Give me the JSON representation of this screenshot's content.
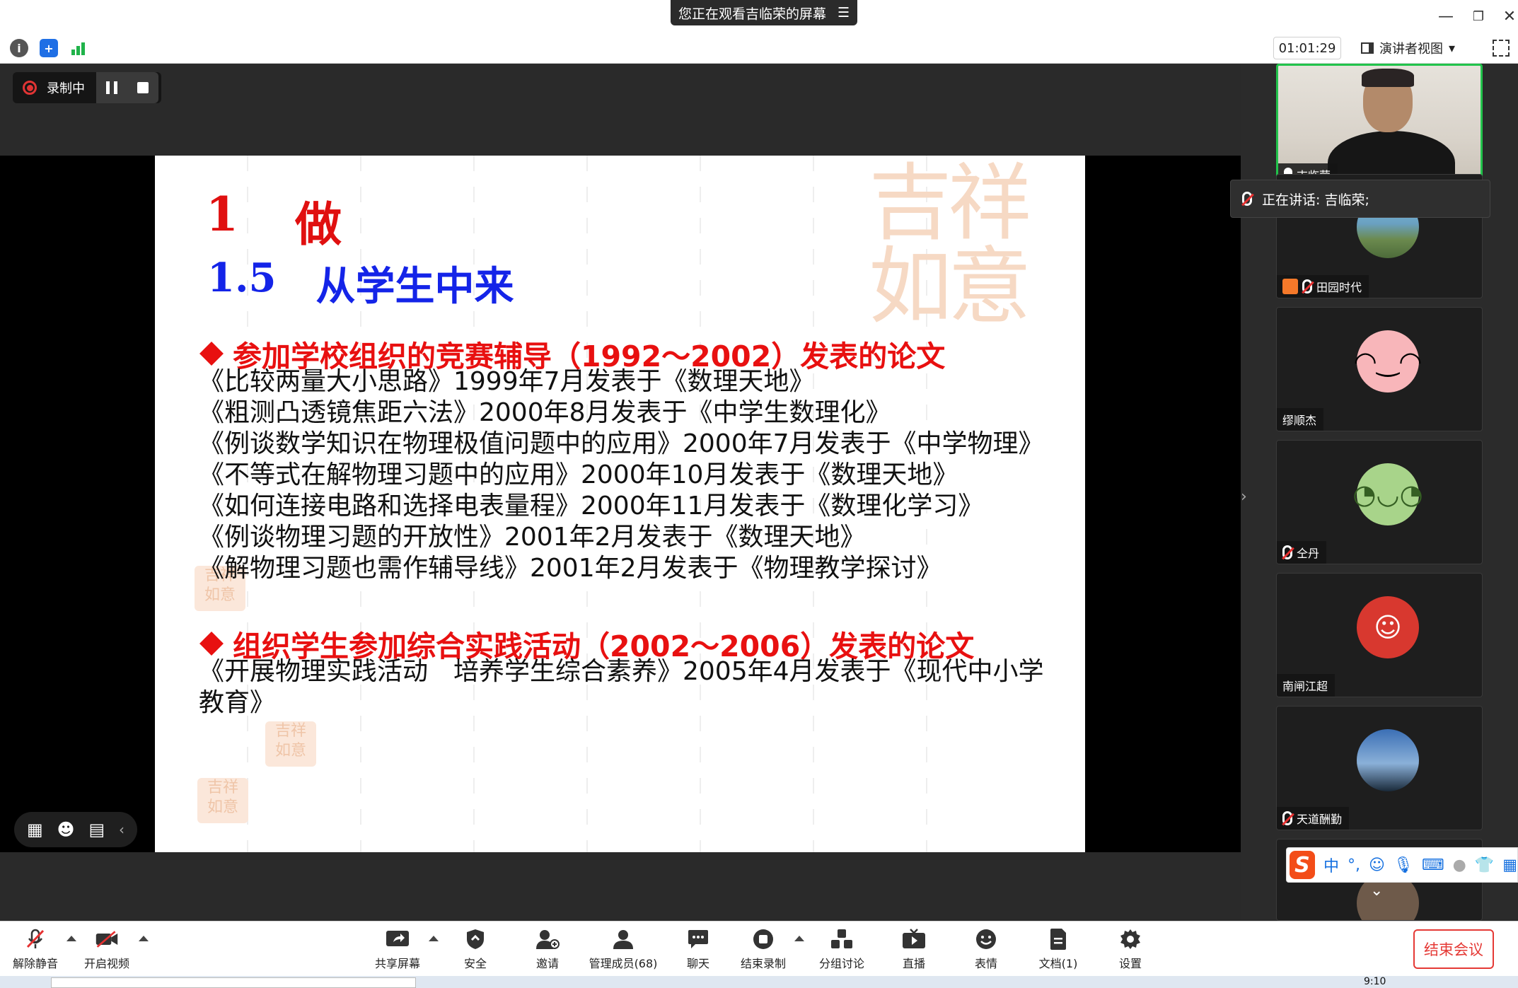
{
  "title_bar": {
    "share_banner": "您正在观看吉临荣的屏幕",
    "minimize": "—",
    "restore": "❐",
    "close": "✕"
  },
  "info_bar": {
    "timer": "01:01:29",
    "view_mode": "演讲者视图",
    "view_caret": "▾"
  },
  "recording": {
    "label": "录制中"
  },
  "slide": {
    "heading_num": "1",
    "heading": "做",
    "sub_num": "1.5",
    "sub_heading": "从学生中来",
    "section1": {
      "title": "参加学校组织的竞赛辅导（1992～2002）发表的论文",
      "papers": [
        "《比较两量大小思路》1999年7月发表于《数理天地》",
        "《粗测凸透镜焦距六法》2000年8月发表于《中学生数理化》",
        "《例谈数学知识在物理极值问题中的应用》2000年7月发表于《中学物理》",
        "《不等式在解物理习题中的应用》2000年10月发表于《数理天地》",
        "《如何连接电路和选择电表量程》2000年11月发表于《数理化学习》",
        "《例谈物理习题的开放性》2001年2月发表于《数理天地》",
        "《解物理习题也需作辅导线》2001年2月发表于《物理教学探讨》"
      ]
    },
    "section2": {
      "title": "组织学生参加综合实践活动（2002～2006）发表的论文",
      "papers": [
        "《开展物理实践活动　培养学生综合素养》2005年4月发表于《现代中小学",
        "教育》"
      ]
    }
  },
  "speaking": {
    "text": "正在讲话: 吉临荣;"
  },
  "participants": [
    {
      "name": "吉临荣",
      "muted": false,
      "active": true
    },
    {
      "name": "田园时代",
      "muted": true
    },
    {
      "name": "缪顺杰",
      "muted": false
    },
    {
      "name": "仝丹",
      "muted": true
    },
    {
      "name": "南闸江超",
      "muted": false
    },
    {
      "name": "天道酬勤",
      "muted": true
    }
  ],
  "ime": {
    "logo": "S",
    "mode": "中",
    "punct": "°,"
  },
  "toolbar": {
    "unmute": "解除静音",
    "start_video": "开启视频",
    "share_screen": "共享屏幕",
    "security": "安全",
    "invite": "邀请",
    "manage_members": "管理成员(68)",
    "chat": "聊天",
    "end_recording": "结束录制",
    "breakout": "分组讨论",
    "live": "直播",
    "reactions": "表情",
    "docs": "文档(1)",
    "settings": "设置",
    "end_meeting": "结束会议"
  },
  "taskbar": {
    "clock": "9:10"
  },
  "colors": {
    "accent_green": "#21c34b",
    "end_red": "#e53935",
    "slide_red": "#e81010",
    "slide_blue": "#1424e8"
  }
}
